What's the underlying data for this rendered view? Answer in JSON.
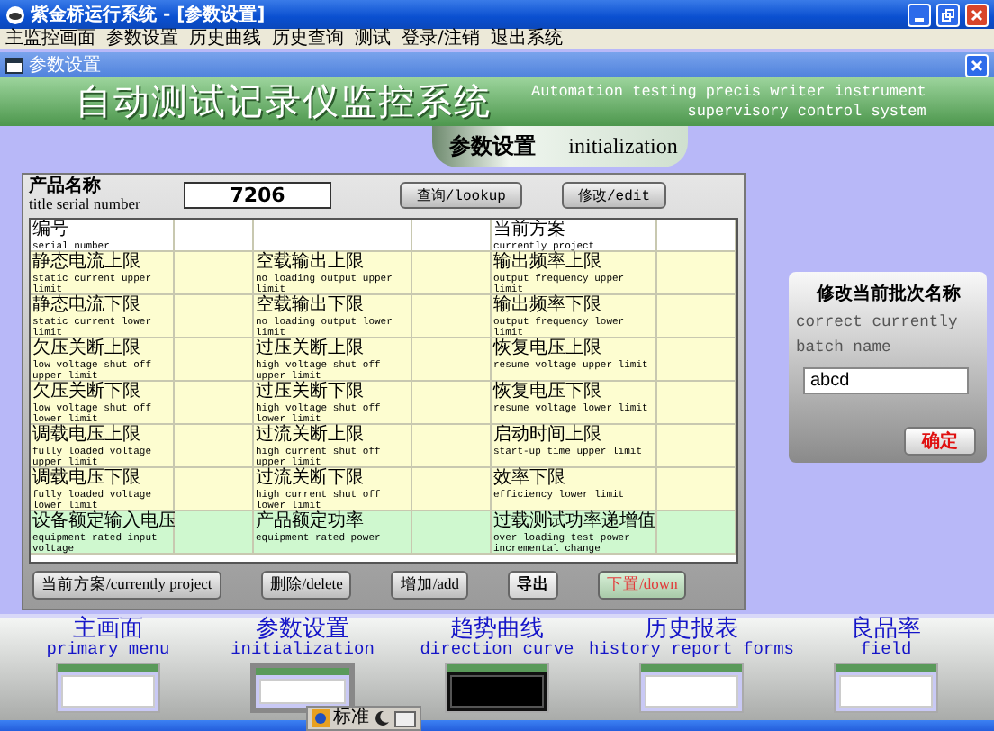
{
  "window": {
    "title": "紫金桥运行系统 - [参数设置]"
  },
  "menu": [
    "主监控画面",
    "参数设置",
    "历史曲线",
    "历史查询",
    "测试",
    "登录/注销",
    "退出系统"
  ],
  "child_window": {
    "title": "参数设置"
  },
  "banner": {
    "title": "自动测试记录仪监控系统",
    "subtitle_1": "Automation testing precis writer instrument",
    "subtitle_2": "supervisory control system"
  },
  "page_tab": {
    "zh": "参数设置",
    "en": "initialization"
  },
  "product": {
    "label_zh": "产品名称",
    "label_en": "title serial number",
    "value": "7206",
    "buttons": [
      "查询/lookup",
      "修改/edit"
    ]
  },
  "table": {
    "header": [
      {
        "zh": "编号",
        "en": "serial number"
      },
      {
        "zh": "当前方案",
        "en": "currently project"
      }
    ],
    "rows": [
      {
        "highlight": false,
        "cells": [
          {
            "zh": "静态电流上限",
            "en": "static current upper limit"
          },
          {
            "zh": "空载输出上限",
            "en": "no loading output upper limit"
          },
          {
            "zh": "输出频率上限",
            "en": "output frequency upper limit"
          }
        ]
      },
      {
        "highlight": false,
        "cells": [
          {
            "zh": "静态电流下限",
            "en": "static current lower limit"
          },
          {
            "zh": "空载输出下限",
            "en": "no loading output lower limit"
          },
          {
            "zh": "输出频率下限",
            "en": "output frequency lower limit"
          }
        ]
      },
      {
        "highlight": false,
        "cells": [
          {
            "zh": "欠压关断上限",
            "en": "low voltage shut off upper limit"
          },
          {
            "zh": "过压关断上限",
            "en": "high voltage shut off upper limit"
          },
          {
            "zh": "恢复电压上限",
            "en": "resume voltage upper limit"
          }
        ]
      },
      {
        "highlight": false,
        "cells": [
          {
            "zh": "欠压关断下限",
            "en": "low voltage shut off lower limit"
          },
          {
            "zh": "过压关断下限",
            "en": "high voltage shut off lower limit"
          },
          {
            "zh": "恢复电压下限",
            "en": "resume voltage lower limit"
          }
        ]
      },
      {
        "highlight": false,
        "cells": [
          {
            "zh": "调载电压上限",
            "en": "fully loaded voltage upper limit"
          },
          {
            "zh": "过流关断上限",
            "en": "high current shut off upper limit"
          },
          {
            "zh": "启动时间上限",
            "en": "start-up time upper limit"
          }
        ]
      },
      {
        "highlight": false,
        "cells": [
          {
            "zh": "调载电压下限",
            "en": "fully loaded voltage lower limit"
          },
          {
            "zh": "过流关断下限",
            "en": "high current shut off lower limit"
          },
          {
            "zh": "效率下限",
            "en": "efficiency lower limit"
          }
        ]
      },
      {
        "highlight": true,
        "cells": [
          {
            "zh": "设备额定输入电压",
            "en": "equipment rated input voltage"
          },
          {
            "zh": "产品额定功率",
            "en": "equipment rated power"
          },
          {
            "zh": "过载测试功率递增值",
            "en": "over loading test power incremental change"
          }
        ]
      }
    ]
  },
  "actions": [
    {
      "label": "当前方案/currently project",
      "kind": "normal"
    },
    {
      "label": "删除/delete",
      "kind": "normal"
    },
    {
      "label": "增加/add",
      "kind": "normal"
    },
    {
      "label": "导出",
      "kind": "bold"
    },
    {
      "label": "下置/down",
      "kind": "alert"
    }
  ],
  "batch": {
    "title": "修改当前批次名称",
    "text_1": "correct currently",
    "text_2": "batch name",
    "value": "abcd",
    "button": "确定"
  },
  "nav": [
    {
      "zh": "主画面",
      "en": "primary menu",
      "selected": false
    },
    {
      "zh": "参数设置",
      "en": "initialization",
      "selected": true
    },
    {
      "zh": "趋势曲线",
      "en": "direction curve",
      "selected": false
    },
    {
      "zh": "历史报表",
      "en": "history report forms",
      "selected": false
    },
    {
      "zh": "良品率",
      "en": "field",
      "selected": false
    }
  ],
  "ime": {
    "label": "标准"
  }
}
